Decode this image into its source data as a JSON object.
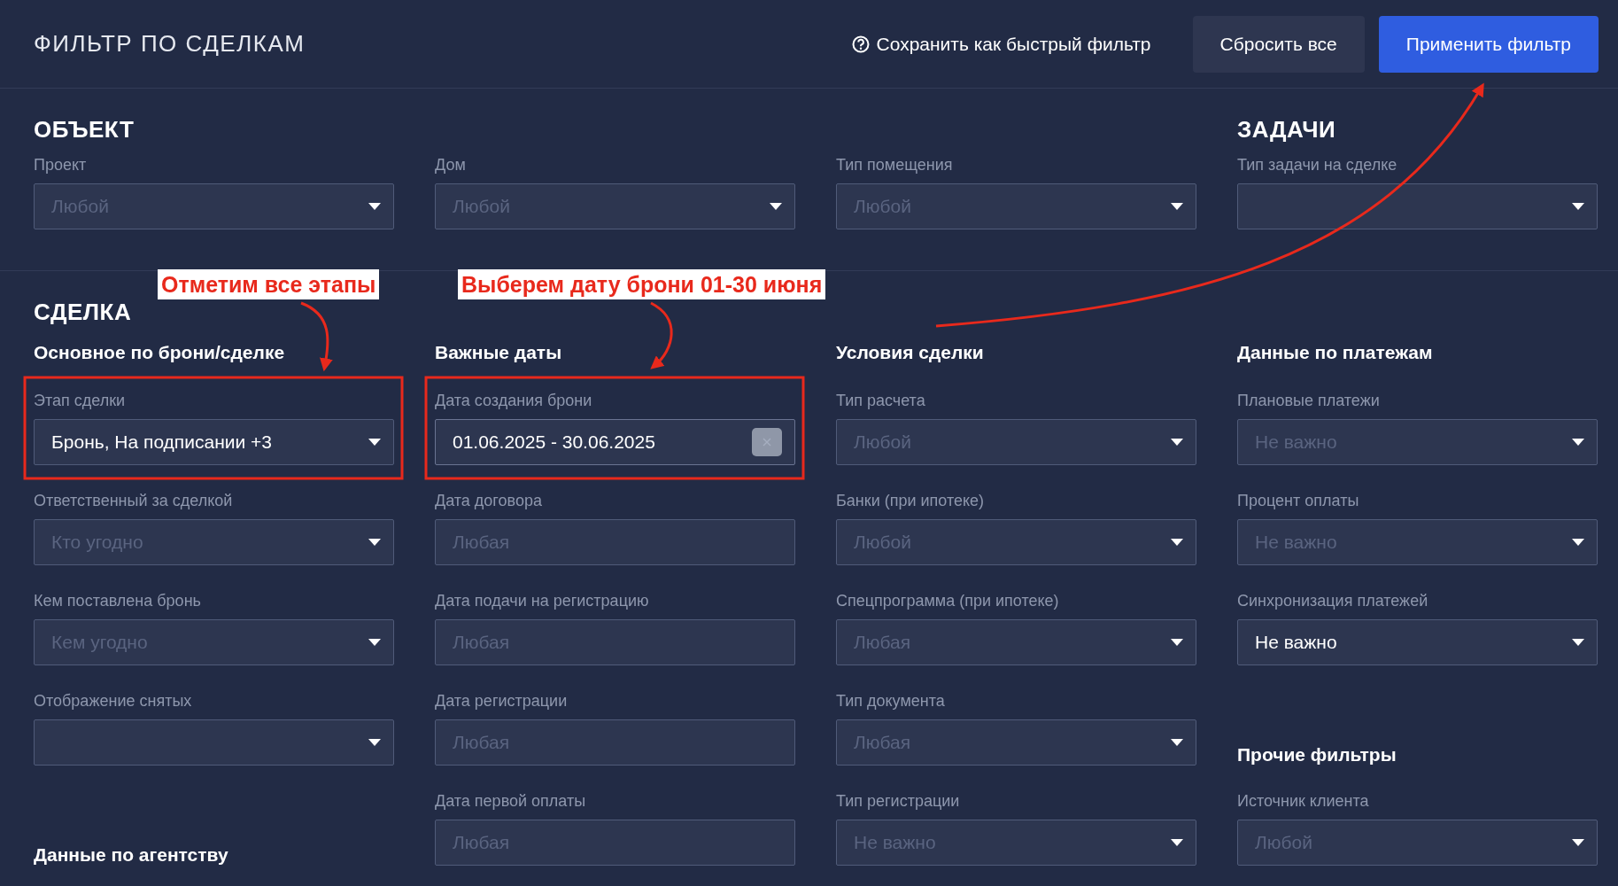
{
  "header": {
    "title": "ФИЛЬТР ПО СДЕЛКАМ",
    "save_link": "Сохранить как быстрый фильтр",
    "buttons": [
      {
        "label": "Сбросить все",
        "kind": "secondary"
      },
      {
        "label": "Применить фильтр",
        "kind": "primary"
      }
    ]
  },
  "object_section": {
    "columns": [
      {
        "heading": "ОБЪЕКТ",
        "items": [
          {
            "kind": "select",
            "label": "Проект",
            "placeholder": "Любой"
          }
        ]
      },
      {
        "items": [
          {
            "kind": "select",
            "label": "Дом",
            "placeholder": "Любой"
          }
        ]
      },
      {
        "items": [
          {
            "kind": "select",
            "label": "Тип помещения",
            "placeholder": "Любой"
          }
        ]
      },
      {
        "heading": "ЗАДАЧИ",
        "items": [
          {
            "kind": "select",
            "label": "Тип задачи на сделке"
          }
        ]
      }
    ]
  },
  "deal_section": {
    "heading": "СДЕЛКА",
    "columns": [
      {
        "title": "Основное по брони/сделке",
        "items": [
          {
            "kind": "select",
            "label": "Этап сделки",
            "value": "Бронь, На подписании +3"
          },
          {
            "kind": "select",
            "label": "Ответственный за сделкой",
            "placeholder": "Кто угодно"
          },
          {
            "kind": "select",
            "label": "Кем поставлена бронь",
            "placeholder": "Кем угодно"
          },
          {
            "kind": "select",
            "label": "Отображение снятых"
          },
          {
            "kind": "group_title",
            "label": "Данные по агентству"
          }
        ]
      },
      {
        "title": "Важные даты",
        "items": [
          {
            "kind": "daterange",
            "label": "Дата создания брони",
            "value": "01.06.2025 - 30.06.2025"
          },
          {
            "kind": "date",
            "label": "Дата договора",
            "placeholder": "Любая"
          },
          {
            "kind": "date",
            "label": "Дата подачи на регистрацию",
            "placeholder": "Любая"
          },
          {
            "kind": "date",
            "label": "Дата регистрации",
            "placeholder": "Любая"
          },
          {
            "kind": "date",
            "label": "Дата первой оплаты",
            "placeholder": "Любая"
          }
        ]
      },
      {
        "title": "Условия сделки",
        "items": [
          {
            "kind": "select",
            "label": "Тип расчета",
            "placeholder": "Любой"
          },
          {
            "kind": "select",
            "label": "Банки (при ипотеке)",
            "placeholder": "Любой"
          },
          {
            "kind": "select",
            "label": "Спецпрограмма (при ипотеке)",
            "placeholder": "Любая"
          },
          {
            "kind": "select",
            "label": "Тип документа",
            "placeholder": "Любая"
          },
          {
            "kind": "select",
            "label": "Тип регистрации",
            "placeholder": "Не важно"
          }
        ]
      },
      {
        "title": "Данные по платежам",
        "items": [
          {
            "kind": "select",
            "label": "Плановые платежи",
            "placeholder": "Не важно"
          },
          {
            "kind": "select",
            "label": "Процент оплаты",
            "placeholder": "Не важно"
          },
          {
            "kind": "select",
            "label": "Синхронизация платежей",
            "value": "Не важно"
          },
          {
            "kind": "group_title",
            "label": "Прочие фильтры"
          },
          {
            "kind": "select",
            "label": "Источник клиента",
            "placeholder": "Любой"
          }
        ]
      }
    ]
  },
  "annotations": [
    {
      "text": "Отметим все этапы"
    },
    {
      "text": "Выберем дату брони 01-30 июня"
    }
  ]
}
